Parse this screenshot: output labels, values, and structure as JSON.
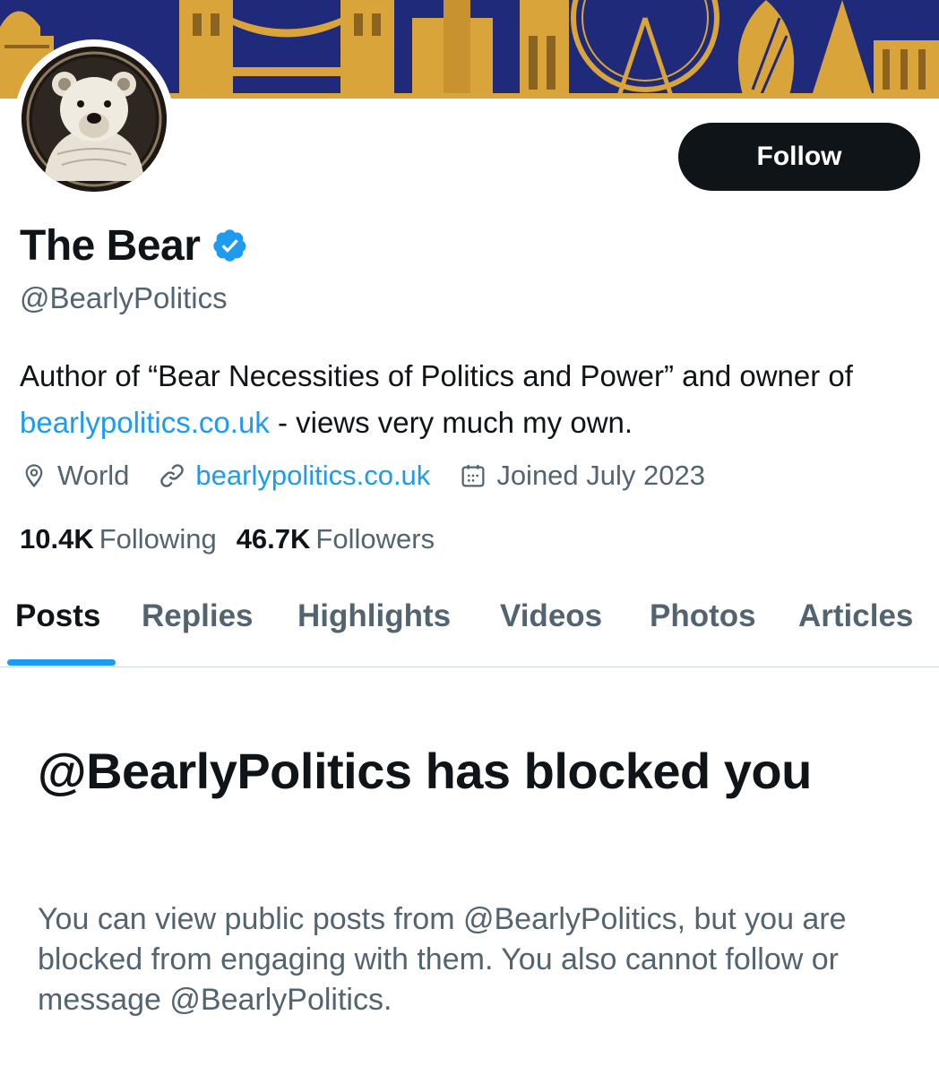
{
  "profile": {
    "display_name": "The Bear",
    "handle": "@BearlyPolitics",
    "follow_label": "Follow",
    "bio": {
      "part1": "Author of “Bear Necessities of Politics and Power” and owner of ",
      "link": "bearlypolitics.co.uk",
      "part2": " - views very much my own."
    },
    "location": "World",
    "website": "bearlypolitics.co.uk",
    "joined": "Joined July 2023",
    "following_count": "10.4K",
    "following_label": "Following",
    "followers_count": "46.7K",
    "followers_label": "Followers"
  },
  "tabs": [
    {
      "label": "Posts",
      "active": true
    },
    {
      "label": "Replies",
      "active": false
    },
    {
      "label": "Highlights",
      "active": false
    },
    {
      "label": "Videos",
      "active": false
    },
    {
      "label": "Photos",
      "active": false
    },
    {
      "label": "Articles",
      "active": false
    }
  ],
  "blocked": {
    "title": "@BearlyPolitics has blocked you",
    "description": "You can view public posts from @BearlyPolitics, but you are blocked from engaging with them. You also cannot follow or message @BearlyPolitics."
  },
  "icons": {
    "verified": "verified-badge-icon",
    "location": "location-pin-icon",
    "link": "link-icon",
    "calendar": "calendar-icon"
  },
  "colors": {
    "accent": "#1d9bf0",
    "text_primary": "#0f1419",
    "text_secondary": "#536471",
    "banner_blue": "#1f2a7a",
    "banner_gold": "#d9a43a",
    "button_dark": "#0f1419"
  }
}
